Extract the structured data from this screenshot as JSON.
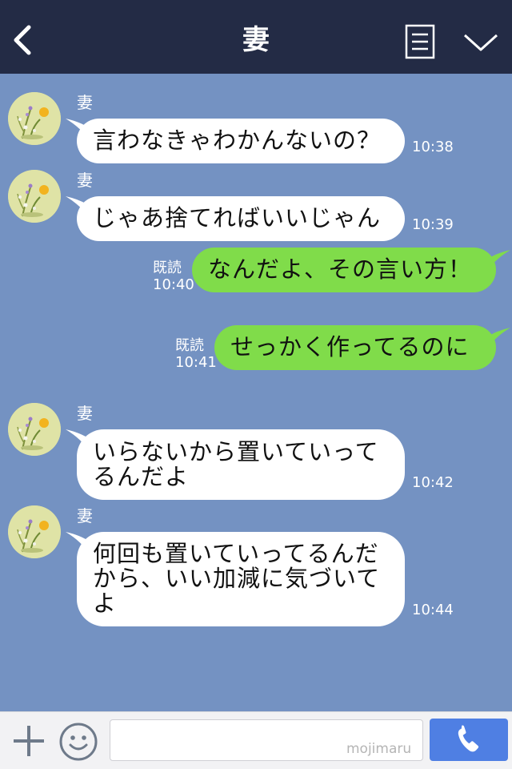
{
  "header": {
    "title": "妻"
  },
  "icons": {
    "back": "chevron-left-icon",
    "menu": "list-icon",
    "collapse": "chevron-down-icon",
    "add": "plus-icon",
    "emoji": "smiley-icon",
    "call": "phone-icon"
  },
  "colors": {
    "header_bg": "#232b45",
    "chat_bg": "#7492c2",
    "incoming_bubble": "#ffffff",
    "outgoing_bubble": "#80dc4a",
    "call_button": "#4f7fe3"
  },
  "messages": [
    {
      "direction": "in",
      "sender": "妻",
      "lines": [
        "言わなきゃわかんないの？"
      ],
      "time": "10:38"
    },
    {
      "direction": "in",
      "sender": "妻",
      "lines": [
        "じゃあ捨てればいいじゃん"
      ],
      "time": "10:39"
    },
    {
      "direction": "out",
      "lines": [
        "なんだよ、その言い方！"
      ],
      "read": "既読",
      "time": "10:40"
    },
    {
      "direction": "out",
      "lines": [
        "せっかく作ってるのに"
      ],
      "read": "既読",
      "time": "10:41"
    },
    {
      "direction": "in",
      "sender": "妻",
      "lines": [
        "いらないから置いていって",
        "るんだよ"
      ],
      "time": "10:42"
    },
    {
      "direction": "in",
      "sender": "妻",
      "lines": [
        "何回も置いていってるんだ",
        "から、いい加減に気づいて",
        "よ"
      ],
      "time": "10:44"
    }
  ],
  "footer": {
    "input_value": "",
    "input_placeholder": "",
    "watermark": "mojimaru"
  }
}
